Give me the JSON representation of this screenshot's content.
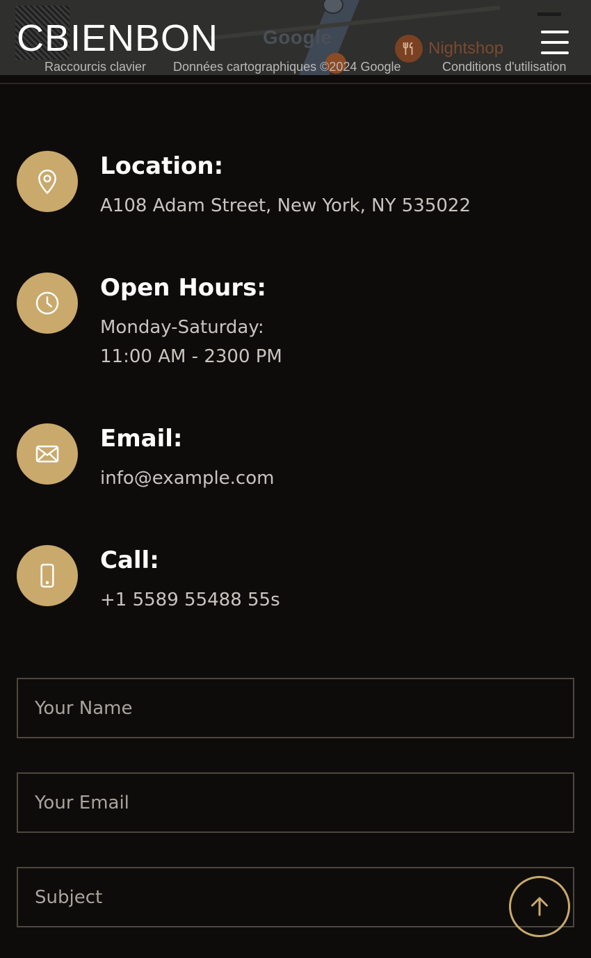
{
  "map": {
    "logo_text": "Google",
    "poi_label": "Nightshop",
    "poi_icon": "restaurant-icon",
    "credits": {
      "shortcuts": "Raccourcis clavier",
      "map_data": "Données cartographiques ©2024 Google",
      "terms": "Conditions d'utilisation"
    }
  },
  "header": {
    "brand": "CBIENBON",
    "menu_icon": "hamburger-menu-icon"
  },
  "contact": {
    "location": {
      "icon": "map-pin-icon",
      "title": "Location:",
      "text": "A108 Adam Street, New York, NY 535022"
    },
    "hours": {
      "icon": "clock-icon",
      "title": "Open Hours:",
      "line1": "Monday-Saturday:",
      "line2": "11:00 AM - 2300 PM"
    },
    "email": {
      "icon": "envelope-icon",
      "title": "Email:",
      "text": "info@example.com"
    },
    "call": {
      "icon": "phone-icon",
      "title": "Call:",
      "text": "+1 5589 55488 55s"
    }
  },
  "form": {
    "name_placeholder": "Your Name",
    "email_placeholder": "Your Email",
    "subject_placeholder": "Subject"
  },
  "back_to_top_icon": "arrow-up-icon",
  "colors": {
    "background": "#0e0c0b",
    "accent": "#c9a96c",
    "text_primary": "#ffffff",
    "text_secondary": "#c8c4bf",
    "field_border": "#4c473f"
  }
}
